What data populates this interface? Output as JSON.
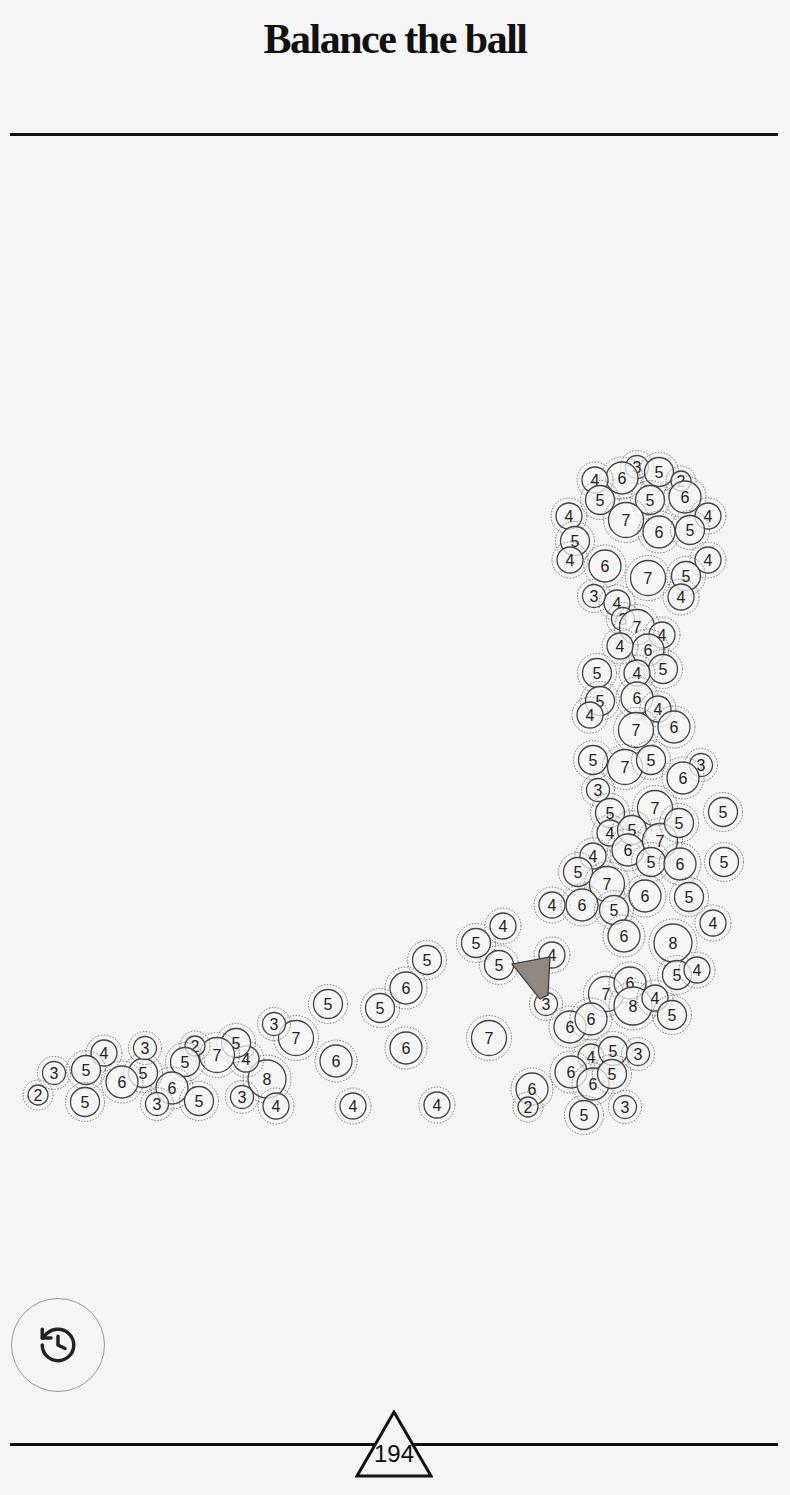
{
  "title": "Balance the ball",
  "score": "194",
  "balls": [
    {
      "label": "3"
    },
    {
      "label": "5"
    },
    {
      "label": "6"
    },
    {
      "label": "4"
    },
    {
      "label": "2"
    },
    {
      "label": "5"
    },
    {
      "label": "5"
    },
    {
      "label": "6"
    },
    {
      "label": "4"
    },
    {
      "label": "4"
    },
    {
      "label": "7"
    },
    {
      "label": "6"
    },
    {
      "label": "5"
    },
    {
      "label": "5"
    },
    {
      "label": "4"
    },
    {
      "label": "6"
    },
    {
      "label": "4"
    },
    {
      "label": "7"
    },
    {
      "label": "5"
    },
    {
      "label": "4"
    },
    {
      "label": "3"
    },
    {
      "label": "4"
    },
    {
      "label": "3"
    },
    {
      "label": "7"
    },
    {
      "label": "4"
    },
    {
      "label": "6"
    },
    {
      "label": "4"
    },
    {
      "label": "5"
    },
    {
      "label": "4"
    },
    {
      "label": "5"
    },
    {
      "label": "6"
    },
    {
      "label": "5"
    },
    {
      "label": "4"
    },
    {
      "label": "4"
    },
    {
      "label": "7"
    },
    {
      "label": "6"
    },
    {
      "label": "5"
    },
    {
      "label": "7"
    },
    {
      "label": "5"
    },
    {
      "label": "3"
    },
    {
      "label": "6"
    },
    {
      "label": "3"
    },
    {
      "label": "5"
    },
    {
      "label": "7"
    },
    {
      "label": "5"
    },
    {
      "label": "4"
    },
    {
      "label": "5"
    },
    {
      "label": "7"
    },
    {
      "label": "5"
    },
    {
      "label": "6"
    },
    {
      "label": "5"
    },
    {
      "label": "6"
    },
    {
      "label": "5"
    },
    {
      "label": "4"
    },
    {
      "label": "5"
    },
    {
      "label": "7"
    },
    {
      "label": "6"
    },
    {
      "label": "5"
    },
    {
      "label": "4"
    },
    {
      "label": "6"
    },
    {
      "label": "5"
    },
    {
      "label": "4"
    },
    {
      "label": "6"
    },
    {
      "label": "8"
    },
    {
      "label": "4"
    },
    {
      "label": "5"
    },
    {
      "label": "4"
    },
    {
      "label": "5"
    },
    {
      "label": "5"
    },
    {
      "label": "4"
    },
    {
      "label": "3"
    },
    {
      "label": "7"
    },
    {
      "label": "6"
    },
    {
      "label": "8"
    },
    {
      "label": "4"
    },
    {
      "label": "5"
    },
    {
      "label": "6"
    },
    {
      "label": "6"
    },
    {
      "label": "4"
    },
    {
      "label": "5"
    },
    {
      "label": "3"
    },
    {
      "label": "6"
    },
    {
      "label": "6"
    },
    {
      "label": "5"
    },
    {
      "label": "5"
    },
    {
      "label": "3"
    },
    {
      "label": "6"
    },
    {
      "label": "2"
    },
    {
      "label": "7"
    },
    {
      "label": "6"
    },
    {
      "label": "4"
    },
    {
      "label": "4"
    },
    {
      "label": "5"
    },
    {
      "label": "6"
    },
    {
      "label": "5"
    },
    {
      "label": "5"
    },
    {
      "label": "6"
    },
    {
      "label": "7"
    },
    {
      "label": "3"
    },
    {
      "label": "8"
    },
    {
      "label": "4"
    },
    {
      "label": "4"
    },
    {
      "label": "3"
    },
    {
      "label": "5"
    },
    {
      "label": "7"
    },
    {
      "label": "2"
    },
    {
      "label": "5"
    },
    {
      "label": "6"
    },
    {
      "label": "5"
    },
    {
      "label": "3"
    },
    {
      "label": "5"
    },
    {
      "label": "3"
    },
    {
      "label": "6"
    },
    {
      "label": "4"
    },
    {
      "label": "5"
    },
    {
      "label": "3"
    },
    {
      "label": "5"
    },
    {
      "label": "2"
    }
  ]
}
